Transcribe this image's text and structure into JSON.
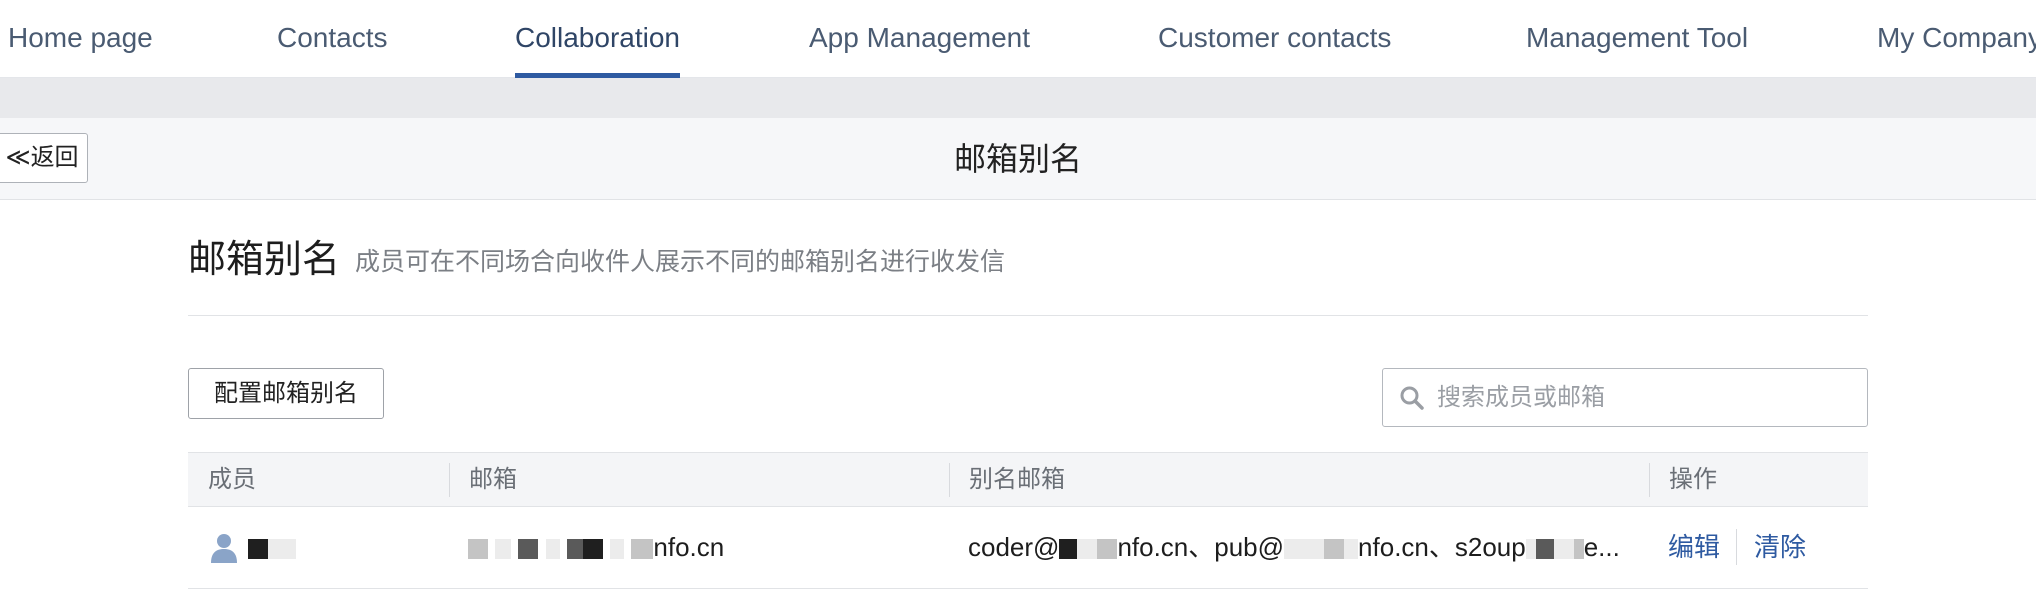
{
  "nav": {
    "items": [
      {
        "label": "Home page"
      },
      {
        "label": "Contacts"
      },
      {
        "label": "Collaboration",
        "active": true
      },
      {
        "label": "App Management"
      },
      {
        "label": "Customer contacts"
      },
      {
        "label": "Management Tool"
      },
      {
        "label": "My Company"
      }
    ]
  },
  "subheader": {
    "back_label": "≪返回",
    "title": "邮箱别名"
  },
  "section": {
    "title": "邮箱别名",
    "description": "成员可在不同场合向收件人展示不同的邮箱别名进行收发信"
  },
  "toolbar": {
    "config_label": "配置邮箱别名",
    "search_placeholder": "搜索成员或邮箱"
  },
  "table": {
    "headers": [
      "成员",
      "邮箱",
      "别名邮箱",
      "操作"
    ],
    "rows": [
      {
        "email_visible": "nfo.cn",
        "alias_part1": "coder@",
        "alias_part2": "nfo.cn、pub@",
        "alias_part3": "nfo.cn、s2oup",
        "alias_part4": "e...",
        "edit_label": "编辑",
        "clear_label": "清除"
      }
    ]
  },
  "colors": {
    "accent": "#2e5aa1",
    "nav_text": "#4a5b72",
    "strip": "#e8e9ec"
  },
  "icons": {
    "back": "double-chevron-left",
    "search": "search-icon",
    "member": "user-icon"
  }
}
